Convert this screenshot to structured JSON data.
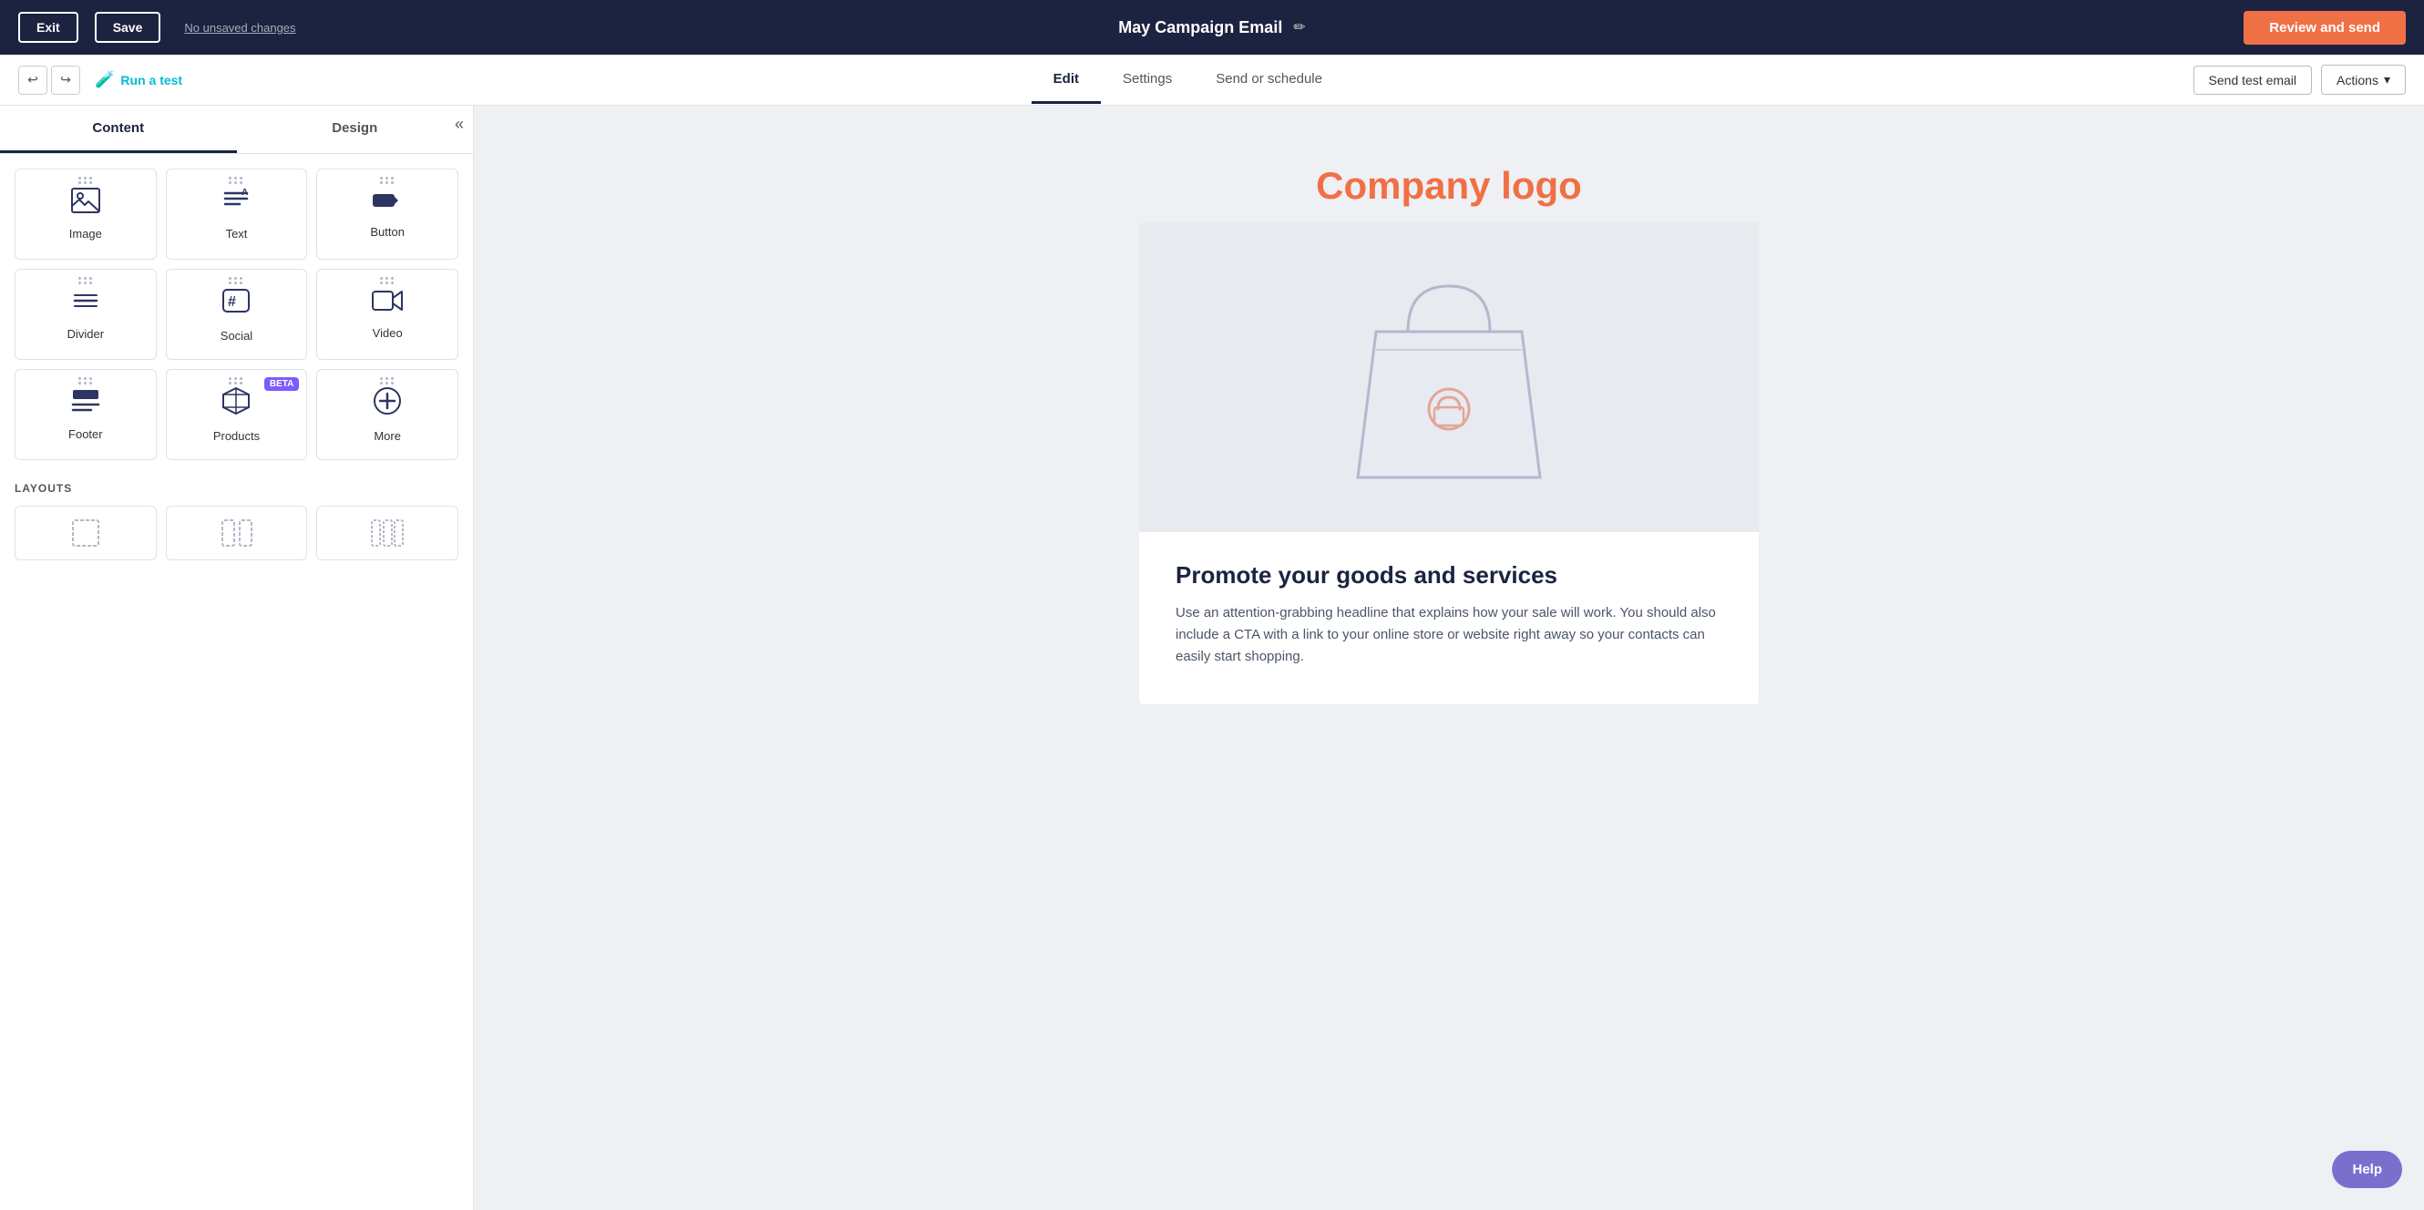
{
  "topbar": {
    "exit_label": "Exit",
    "save_label": "Save",
    "unsaved_label": "No unsaved changes",
    "title": "May Campaign Email",
    "edit_icon": "✏",
    "review_label": "Review and send"
  },
  "secondbar": {
    "undo_icon": "↩",
    "redo_icon": "↪",
    "run_test_label": "Run a test",
    "tabs": [
      {
        "label": "Edit",
        "active": true
      },
      {
        "label": "Settings",
        "active": false
      },
      {
        "label": "Send or schedule",
        "active": false
      }
    ],
    "send_test_label": "Send test email",
    "actions_label": "Actions",
    "actions_chevron": "▾"
  },
  "sidebar": {
    "content_tab": "Content",
    "design_tab": "Design",
    "blocks": [
      {
        "id": "image",
        "label": "Image",
        "icon": "🖼"
      },
      {
        "id": "text",
        "label": "Text",
        "icon": "≡"
      },
      {
        "id": "button",
        "label": "Button",
        "icon": "▬"
      },
      {
        "id": "divider",
        "label": "Divider",
        "icon": "☰"
      },
      {
        "id": "social",
        "label": "Social",
        "icon": "#"
      },
      {
        "id": "video",
        "label": "Video",
        "icon": "▶"
      },
      {
        "id": "footer",
        "label": "Footer",
        "icon": "☰"
      },
      {
        "id": "products",
        "label": "Products",
        "icon": "⬡",
        "beta": true
      },
      {
        "id": "more",
        "label": "More",
        "icon": "+"
      }
    ],
    "layouts_title": "LAYOUTS"
  },
  "canvas": {
    "logo_text": "Company logo",
    "headline": "Promote your goods and services",
    "body_text": "Use an attention-grabbing headline that explains how your sale will work. You should also include a CTA with a link to your online store or website right away so your contacts can easily start shopping."
  },
  "help": {
    "label": "Help"
  }
}
